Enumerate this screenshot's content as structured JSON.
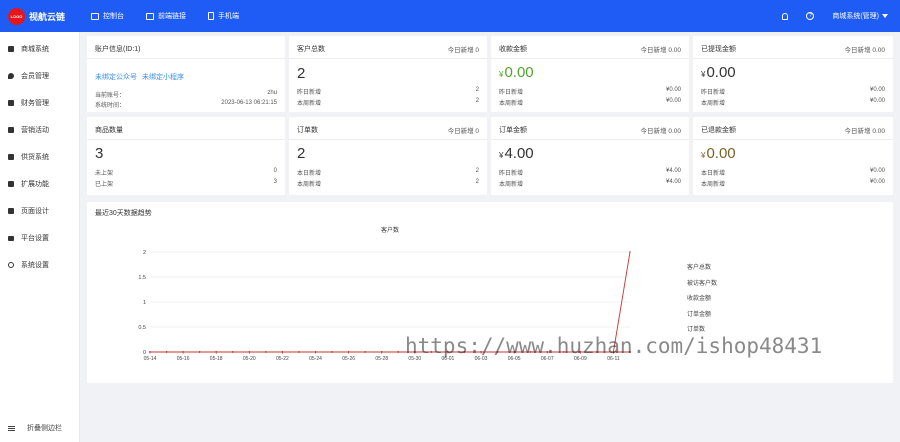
{
  "topbar": {
    "logo_text": "LOGO",
    "brand": "视航云链",
    "nav": [
      {
        "label": "控制台"
      },
      {
        "label": "前端链接"
      },
      {
        "label": "手机端"
      }
    ],
    "account": "商城系统(管理)"
  },
  "sidebar": {
    "items": [
      {
        "label": "商城系统"
      },
      {
        "label": "会员管理"
      },
      {
        "label": "财务管理"
      },
      {
        "label": "营销活动"
      },
      {
        "label": "供货系统"
      },
      {
        "label": "扩展功能"
      },
      {
        "label": "页面设计"
      },
      {
        "label": "平台设置"
      },
      {
        "label": "系统设置"
      }
    ],
    "collapse_label": "折叠侧边栏"
  },
  "account_card": {
    "title": "账户信息(ID:1)",
    "link1": "未绑定公众号",
    "link2": "未绑定小程序",
    "rows": [
      {
        "label": "当前账号：",
        "value": "zhu"
      },
      {
        "label": "系统时间：",
        "value": "2023-06-13 06:21:15"
      }
    ]
  },
  "stats": [
    {
      "title": "客户总数",
      "today": "今日新增 0",
      "value": "2",
      "currency": "",
      "rows": [
        {
          "label": "昨日新增",
          "value": "2"
        },
        {
          "label": "本周新增",
          "value": "2"
        }
      ]
    },
    {
      "title": "收款金额",
      "today": "今日新增 0.00",
      "value": "0.00",
      "currency": "¥",
      "rows": [
        {
          "label": "昨日新增",
          "value": "¥0.00"
        },
        {
          "label": "本周新增",
          "value": "¥0.00"
        }
      ]
    },
    {
      "title": "已提现金额",
      "today": "今日新增 0.00",
      "value": "0.00",
      "currency": "¥",
      "rows": [
        {
          "label": "昨日新增",
          "value": "¥0.00"
        },
        {
          "label": "本周新增",
          "value": "¥0.00"
        }
      ]
    },
    {
      "title": "商品数量",
      "today": "",
      "value": "3",
      "currency": "",
      "rows": [
        {
          "label": "未上架",
          "value": "0"
        },
        {
          "label": "已上架",
          "value": "3"
        }
      ]
    },
    {
      "title": "订单数",
      "today": "今日新增 0",
      "value": "2",
      "currency": "",
      "rows": [
        {
          "label": "本日新增",
          "value": "2"
        },
        {
          "label": "本周新增",
          "value": "2"
        }
      ]
    },
    {
      "title": "订单金额",
      "today": "今日新增 0.00",
      "value": "4.00",
      "currency": "¥",
      "rows": [
        {
          "label": "昨日新增",
          "value": "¥4.00"
        },
        {
          "label": "本周新增",
          "value": "¥4.00"
        }
      ]
    },
    {
      "title": "已退款金额",
      "today": "今日新增 0.00",
      "value": "0.00",
      "currency": "¥",
      "rows": [
        {
          "label": "本日新增",
          "value": "¥0.00"
        },
        {
          "label": "本周新增",
          "value": "¥0.00"
        }
      ]
    }
  ],
  "colors": {
    "accent": "#1e5cf5",
    "green_value": "#52a32e",
    "olive_value": "#7a6224",
    "line": "#c23531"
  },
  "chart_section_title": "最近30天数据趋势",
  "chart_data": {
    "type": "line",
    "title": "客户数",
    "x": [
      "05-14",
      "05-15",
      "05-16",
      "05-17",
      "05-18",
      "05-19",
      "05-20",
      "05-21",
      "05-22",
      "05-23",
      "05-24",
      "05-25",
      "05-26",
      "05-27",
      "05-28",
      "05-29",
      "05-30",
      "05-31",
      "06-01",
      "06-02",
      "06-03",
      "06-04",
      "06-05",
      "06-06",
      "06-07",
      "06-08",
      "06-09",
      "06-10",
      "06-11",
      "06-12"
    ],
    "x_tick_labels": [
      "05-14",
      "05-16",
      "05-18",
      "05-20",
      "05-22",
      "05-24",
      "05-26",
      "05-28",
      "05-30",
      "06-01",
      "06-03",
      "06-05",
      "06-07",
      "06-09",
      "06-11"
    ],
    "y_ticks": [
      "0",
      "0.5",
      "1",
      "1.5",
      "2"
    ],
    "ylim": [
      0,
      2
    ],
    "grid": true,
    "legend_placement": "right",
    "series": [
      {
        "name": "客户总数",
        "values": [
          0,
          0,
          0,
          0,
          0,
          0,
          0,
          0,
          0,
          0,
          0,
          0,
          0,
          0,
          0,
          0,
          0,
          0,
          0,
          0,
          0,
          0,
          0,
          0,
          0,
          0,
          0,
          0,
          0,
          2
        ]
      },
      {
        "name": "被访客户数",
        "values": [
          0,
          0,
          0,
          0,
          0,
          0,
          0,
          0,
          0,
          0,
          0,
          0,
          0,
          0,
          0,
          0,
          0,
          0,
          0,
          0,
          0,
          0,
          0,
          0,
          0,
          0,
          0,
          0,
          0,
          0
        ]
      },
      {
        "name": "收款金额",
        "values": [
          0,
          0,
          0,
          0,
          0,
          0,
          0,
          0,
          0,
          0,
          0,
          0,
          0,
          0,
          0,
          0,
          0,
          0,
          0,
          0,
          0,
          0,
          0,
          0,
          0,
          0,
          0,
          0,
          0,
          0
        ]
      },
      {
        "name": "订单金额",
        "values": [
          0,
          0,
          0,
          0,
          0,
          0,
          0,
          0,
          0,
          0,
          0,
          0,
          0,
          0,
          0,
          0,
          0,
          0,
          0,
          0,
          0,
          0,
          0,
          0,
          0,
          0,
          0,
          0,
          0,
          0
        ]
      },
      {
        "name": "订单数",
        "values": [
          0,
          0,
          0,
          0,
          0,
          0,
          0,
          0,
          0,
          0,
          0,
          0,
          0,
          0,
          0,
          0,
          0,
          0,
          0,
          0,
          0,
          0,
          0,
          0,
          0,
          0,
          0,
          0,
          0,
          0
        ]
      }
    ]
  },
  "watermark": "https://www.huzhan.com/ishop48431"
}
